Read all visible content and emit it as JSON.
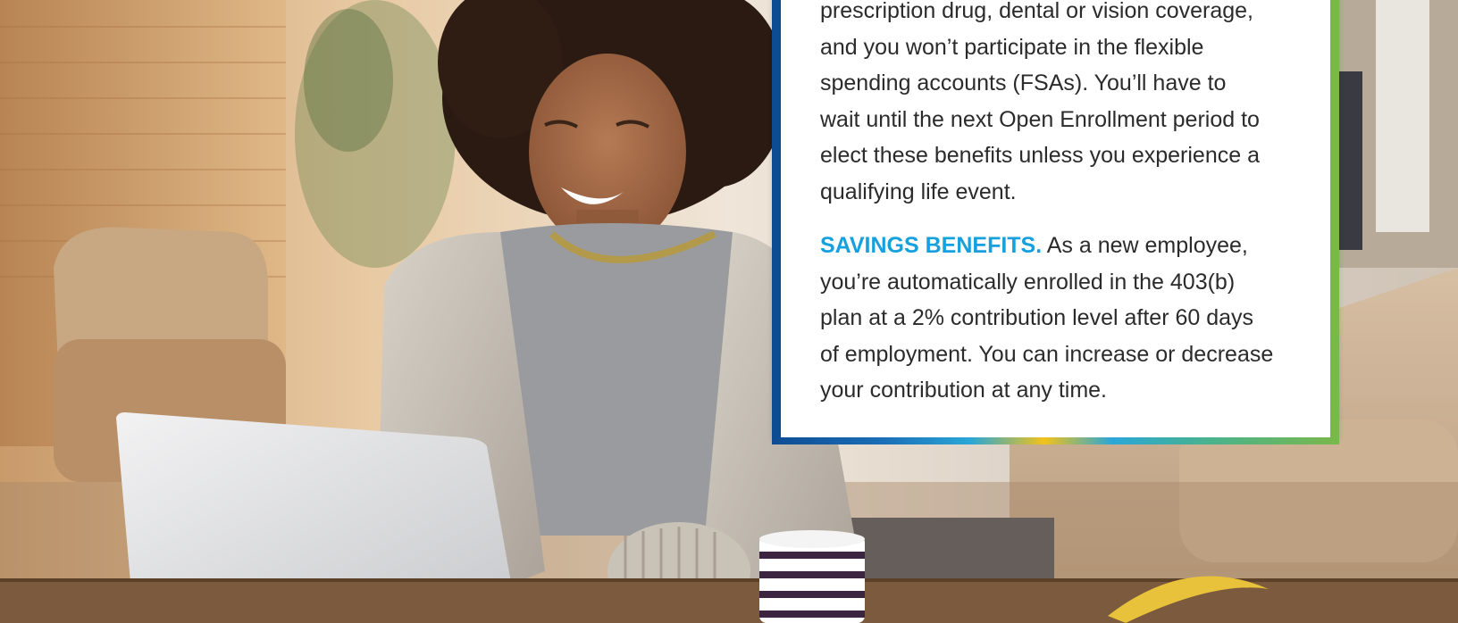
{
  "card": {
    "p1_lines": [
      "prescription drug, dental or vision coverage,",
      "and you won’t participate in the flexible",
      "spending accounts (FSAs). You’ll have to",
      "wait until the next Open Enrollment period to",
      "elect these benefits unless you experience a",
      "qualifying life event."
    ],
    "p2_heading": "SAVINGS BENEFITS.",
    "p2_lines": [
      " As a new employee,",
      "you’re automatically enrolled in the 403(b)",
      "plan at a 2% contribution level after 60 days",
      "of employment. You can increase or decrease",
      "your contribution at any time."
    ]
  },
  "colors": {
    "heading_accent": "#17a0de",
    "card_left_border": "#0d4c92",
    "card_right_border": "#7ab84a",
    "body_text": "#2b2b2b"
  }
}
